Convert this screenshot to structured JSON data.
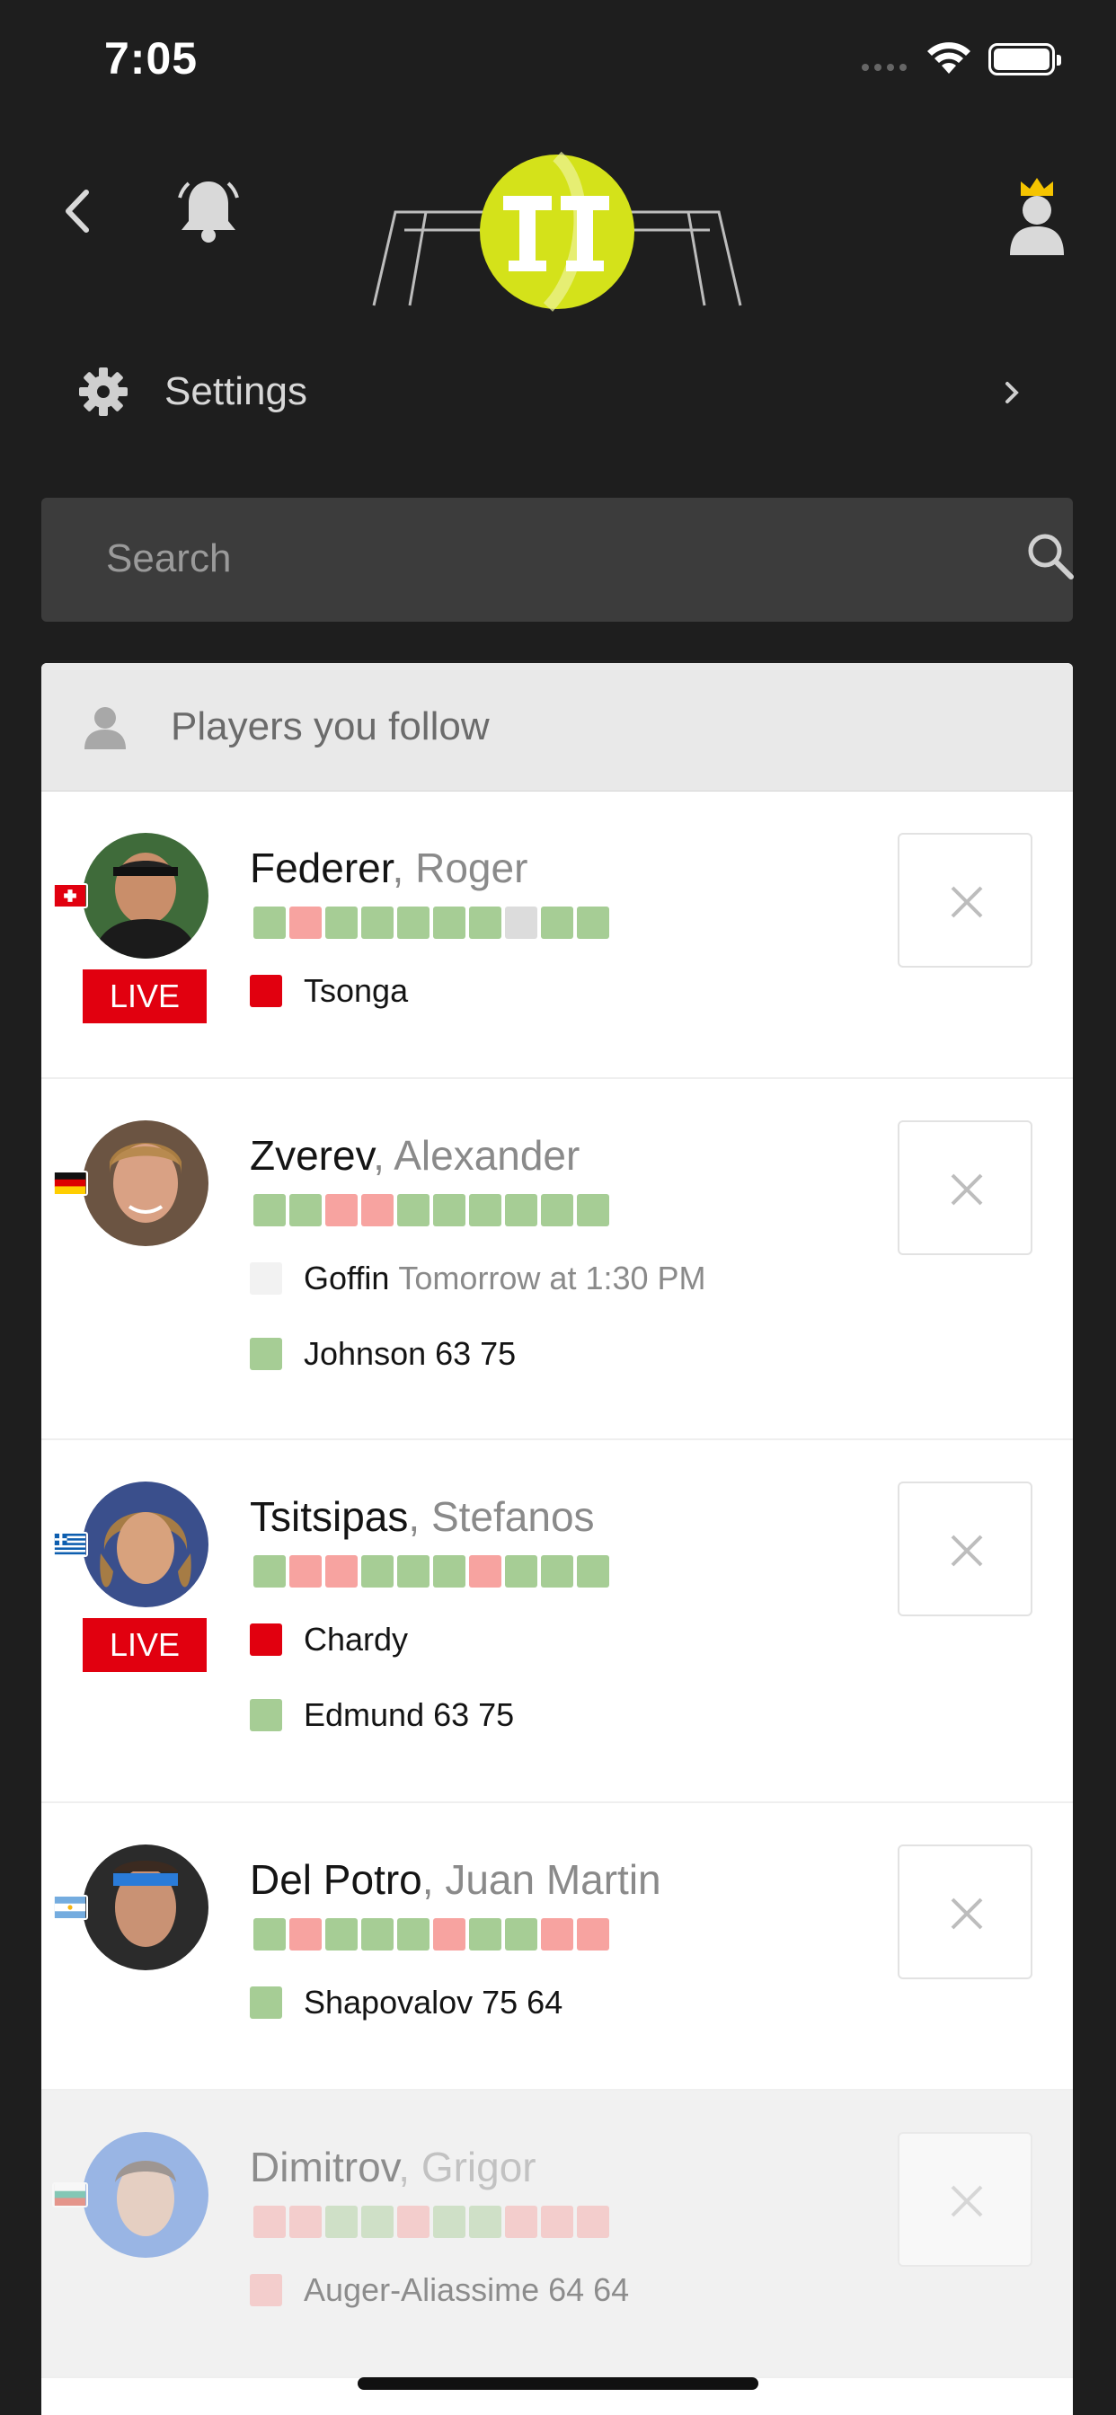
{
  "status_bar": {
    "time": "7:05"
  },
  "nav": {
    "back_icon": "chevron-left-icon",
    "notifications_icon": "bell-icon",
    "logo": "tennis-temple-logo",
    "profile_icon": "crowned-user-icon"
  },
  "settings": {
    "label": "Settings",
    "icon": "gear-icon"
  },
  "search": {
    "placeholder": "Search",
    "icon": "search-icon"
  },
  "players_section": {
    "title": "Players you follow",
    "players": [
      {
        "last_name": "Federer",
        "separator": ", ",
        "first_name": "Roger",
        "flag": "Switzerland",
        "live": true,
        "live_label": "LIVE",
        "recent_results": [
          "W",
          "L",
          "W",
          "W",
          "W",
          "W",
          "W",
          "N",
          "W",
          "W"
        ],
        "matches": [
          {
            "status": "live",
            "text": "Tsonga",
            "when": ""
          }
        ]
      },
      {
        "last_name": "Zverev",
        "separator": ", ",
        "first_name": "Alexander",
        "flag": "Germany",
        "live": false,
        "recent_results": [
          "W",
          "W",
          "L",
          "L",
          "W",
          "W",
          "W",
          "W",
          "W",
          "W"
        ],
        "matches": [
          {
            "status": "upcoming",
            "text": "Goffin",
            "when": "Tomorrow at 1:30 PM"
          },
          {
            "status": "won",
            "text": "Johnson 63 75",
            "when": ""
          }
        ]
      },
      {
        "last_name": "Tsitsipas",
        "separator": ", ",
        "first_name": "Stefanos",
        "flag": "Greece",
        "live": true,
        "live_label": "LIVE",
        "recent_results": [
          "W",
          "L",
          "L",
          "W",
          "W",
          "W",
          "L",
          "W",
          "W",
          "W"
        ],
        "matches": [
          {
            "status": "live",
            "text": "Chardy",
            "when": ""
          },
          {
            "status": "won",
            "text": "Edmund 63 75",
            "when": ""
          }
        ]
      },
      {
        "last_name": "Del Potro",
        "separator": ", ",
        "first_name": "Juan Martin",
        "flag": "Argentina",
        "live": false,
        "recent_results": [
          "W",
          "L",
          "W",
          "W",
          "W",
          "L",
          "W",
          "W",
          "L",
          "L"
        ],
        "matches": [
          {
            "status": "won",
            "text": "Shapovalov 75 64",
            "when": ""
          }
        ]
      },
      {
        "last_name": "Dimitrov",
        "separator": ", ",
        "first_name": "Grigor",
        "flag": "Bulgaria",
        "live": false,
        "recent_results": [
          "L",
          "L",
          "W",
          "W",
          "L",
          "W",
          "W",
          "L",
          "L",
          "L"
        ],
        "matches": [
          {
            "status": "lost",
            "text": "Auger-Aliassime 64 64",
            "when": ""
          }
        ]
      }
    ]
  },
  "colors": {
    "background": "#1e1e1e",
    "live_red": "#e1000f",
    "win_green": "#a6cd95",
    "loss_pink": "#f7a3a0",
    "logo_yellow": "#d4e21a"
  }
}
